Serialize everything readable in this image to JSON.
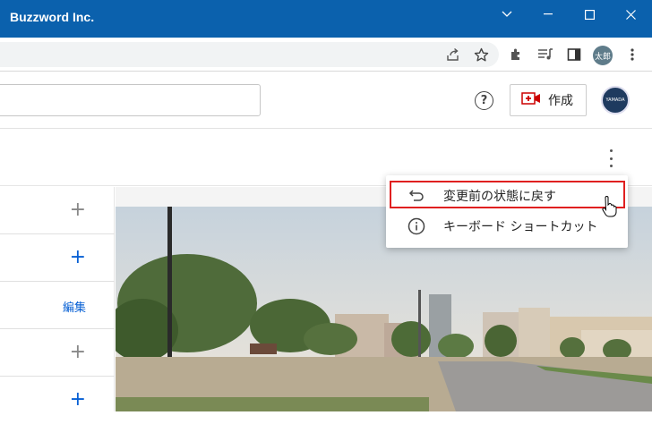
{
  "window": {
    "title": "Buzzword Inc.",
    "titlebar_color": "#0b61ad"
  },
  "browser": {
    "profile_label": "太郎",
    "toolbar_icons": [
      "share-icon",
      "star-icon",
      "extensions-icon",
      "media-icon",
      "sidepanel-icon",
      "profile-avatar",
      "more-icon"
    ]
  },
  "header": {
    "help_label": "?",
    "create_label": "作成",
    "avatar_label": "YAMADA"
  },
  "list": {
    "rows": [
      {
        "action": "+"
      },
      {
        "action": "+"
      },
      {
        "action": "編集"
      },
      {
        "action": "+"
      },
      {
        "action": "+"
      }
    ]
  },
  "menu": {
    "items": [
      {
        "icon": "undo-icon",
        "label": "変更前の状態に戻す",
        "highlighted": true
      },
      {
        "icon": "info-icon",
        "label": "キーボード ショートカット",
        "highlighted": false
      }
    ],
    "highlight_color": "#e02020"
  },
  "accent_color": "#065fd4"
}
